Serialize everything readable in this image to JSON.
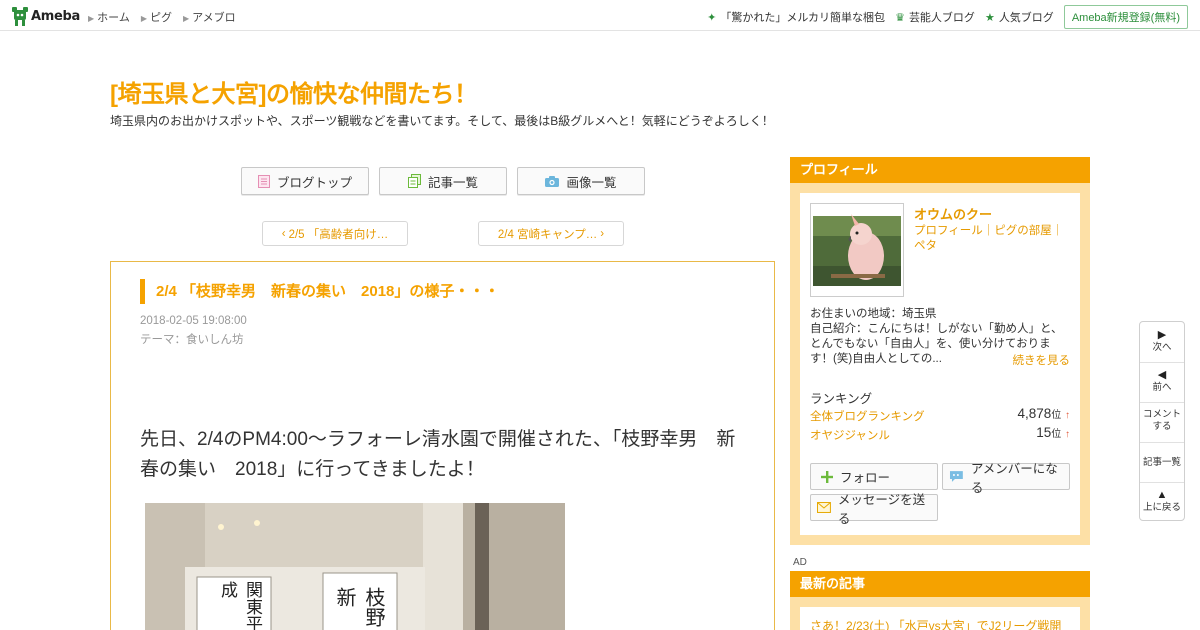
{
  "header": {
    "logo_text": "Ameba",
    "nav": [
      "ホーム",
      "ピグ",
      "アメブロ"
    ],
    "promo": "「驚かれた」メルカリ簡単な梱包",
    "celeb_blog": "芸能人ブログ",
    "popular_blog": "人気ブログ",
    "register": "Ameba新規登録(無料)",
    "accent_color": "#2d8f3c"
  },
  "blog": {
    "title": "[埼玉県と大宮]の愉快な仲間たち！",
    "description": "埼玉県内のお出かけスポットや、スポーツ観戦などを書いてます。そして、最後はB級グルメへと！気軽にどうぞよろしく！",
    "accent_color": "#f5a200"
  },
  "menu": {
    "blog_top": "ブログトップ",
    "entry_list": "記事一覧",
    "image_list": "画像一覧"
  },
  "pager": {
    "prev": "2/5 「高齢者向け…",
    "next": "2/4 宮崎キャンプ…"
  },
  "article": {
    "title": "2/4 「枝野幸男　新春の集い　2018」の様子・・・",
    "date": "2018-02-05 19:08:00",
    "theme_label": "テーマ：",
    "theme": "食いしん坊",
    "body": "先日、2/4のPM4:00～ラフォーレ清水園で開催された、「枝野幸男　新春の集い　2018」に行ってきましたよ！",
    "photo_sign_1": "関東平成",
    "photo_sign_2": "枝野新"
  },
  "profile": {
    "header": "プロフィール",
    "name": "オウムのクー",
    "links": "プロフィール｜ピグの部屋｜ペタ",
    "text": "お住まいの地域：埼玉県\n自己紹介：こんにちは！しがない「勤め人」と、とんでもない「自由人」を、使い分けております！(笑)自由人としての...",
    "more": "続きを見る",
    "ranking_label": "ランキング",
    "rankings": [
      {
        "name": "全体ブログランキング",
        "value": "4,878",
        "unit": "位",
        "trend": "↑"
      },
      {
        "name": "オヤジジャンル",
        "value": "15",
        "unit": "位",
        "trend": "↑"
      }
    ],
    "follow": "フォロー",
    "amember": "アメンバーになる",
    "message": "メッセージを送る"
  },
  "ad_label": "AD",
  "latest": {
    "header": "最新の記事",
    "items": [
      "さあ！2/23(土) 「水戸vs大宮」でJ2リーグ戦開"
    ]
  },
  "float_nav": {
    "next": "次へ",
    "prev": "前へ",
    "comment": "コメントする",
    "entry_list": "記事一覧",
    "top": "上に戻る"
  }
}
